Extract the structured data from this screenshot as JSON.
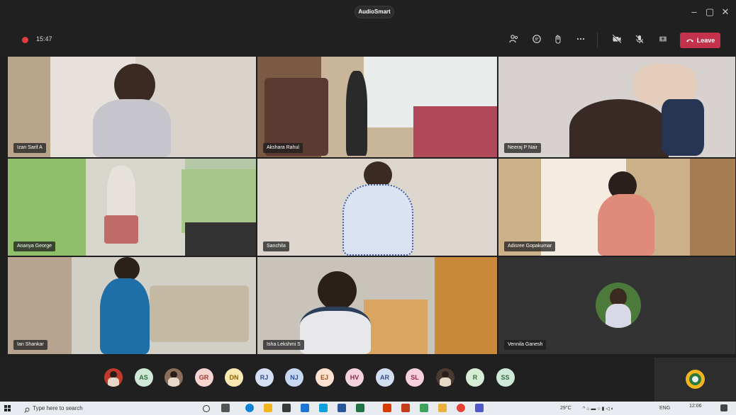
{
  "window": {
    "title": "AudioSmart",
    "minimize": "–",
    "restore": "▢",
    "close": "✕"
  },
  "toolbar": {
    "recording_time": "15:47",
    "leave_label": "Leave"
  },
  "participants_tiles": [
    {
      "name": "Izan Sarif A"
    },
    {
      "name": "Akshara Rahul"
    },
    {
      "name": "Neeraj P Nair"
    },
    {
      "name": "Ananya George"
    },
    {
      "name": "Sanchila"
    },
    {
      "name": "Adisree Gopakumar"
    },
    {
      "name": "Ian Shankar"
    },
    {
      "name": "Isha Lekshmi S"
    },
    {
      "name": "Vennila Ganesh"
    }
  ],
  "roster": [
    {
      "initials": "",
      "kind": "photo",
      "color": "#c0392b"
    },
    {
      "initials": "AS",
      "kind": "initials",
      "color": "#cfe8d6",
      "fg": "#2f6b3f"
    },
    {
      "initials": "",
      "kind": "photo",
      "color": "#8a6e59"
    },
    {
      "initials": "GR",
      "kind": "initials",
      "color": "#f6d4cf",
      "fg": "#9a3b30"
    },
    {
      "initials": "DN",
      "kind": "initials",
      "color": "#fbe7b2",
      "fg": "#8a6300"
    },
    {
      "initials": "RJ",
      "kind": "initials",
      "color": "#d6e0f5",
      "fg": "#34508f"
    },
    {
      "initials": "NJ",
      "kind": "initials",
      "color": "#c8d8f2",
      "fg": "#2d4f8e"
    },
    {
      "initials": "EJ",
      "kind": "initials",
      "color": "#fde2cf",
      "fg": "#a04d16"
    },
    {
      "initials": "HV",
      "kind": "initials",
      "color": "#f3d2de",
      "fg": "#8a2a4e"
    },
    {
      "initials": "AR",
      "kind": "initials",
      "color": "#d2def2",
      "fg": "#32518a"
    },
    {
      "initials": "SL",
      "kind": "initials",
      "color": "#f6d0dc",
      "fg": "#8c2b4c"
    },
    {
      "initials": "",
      "kind": "photo",
      "color": "#4a3a30"
    },
    {
      "initials": "R",
      "kind": "initials",
      "color": "#d5ecd5",
      "fg": "#3d6e3d"
    },
    {
      "initials": "SS",
      "kind": "initials",
      "color": "#cfe9d8",
      "fg": "#2f6a47"
    }
  ],
  "taskbar": {
    "search_placeholder": "Type here to search",
    "weather": "29°C",
    "language": "ENG",
    "clock_time": "12:06"
  }
}
